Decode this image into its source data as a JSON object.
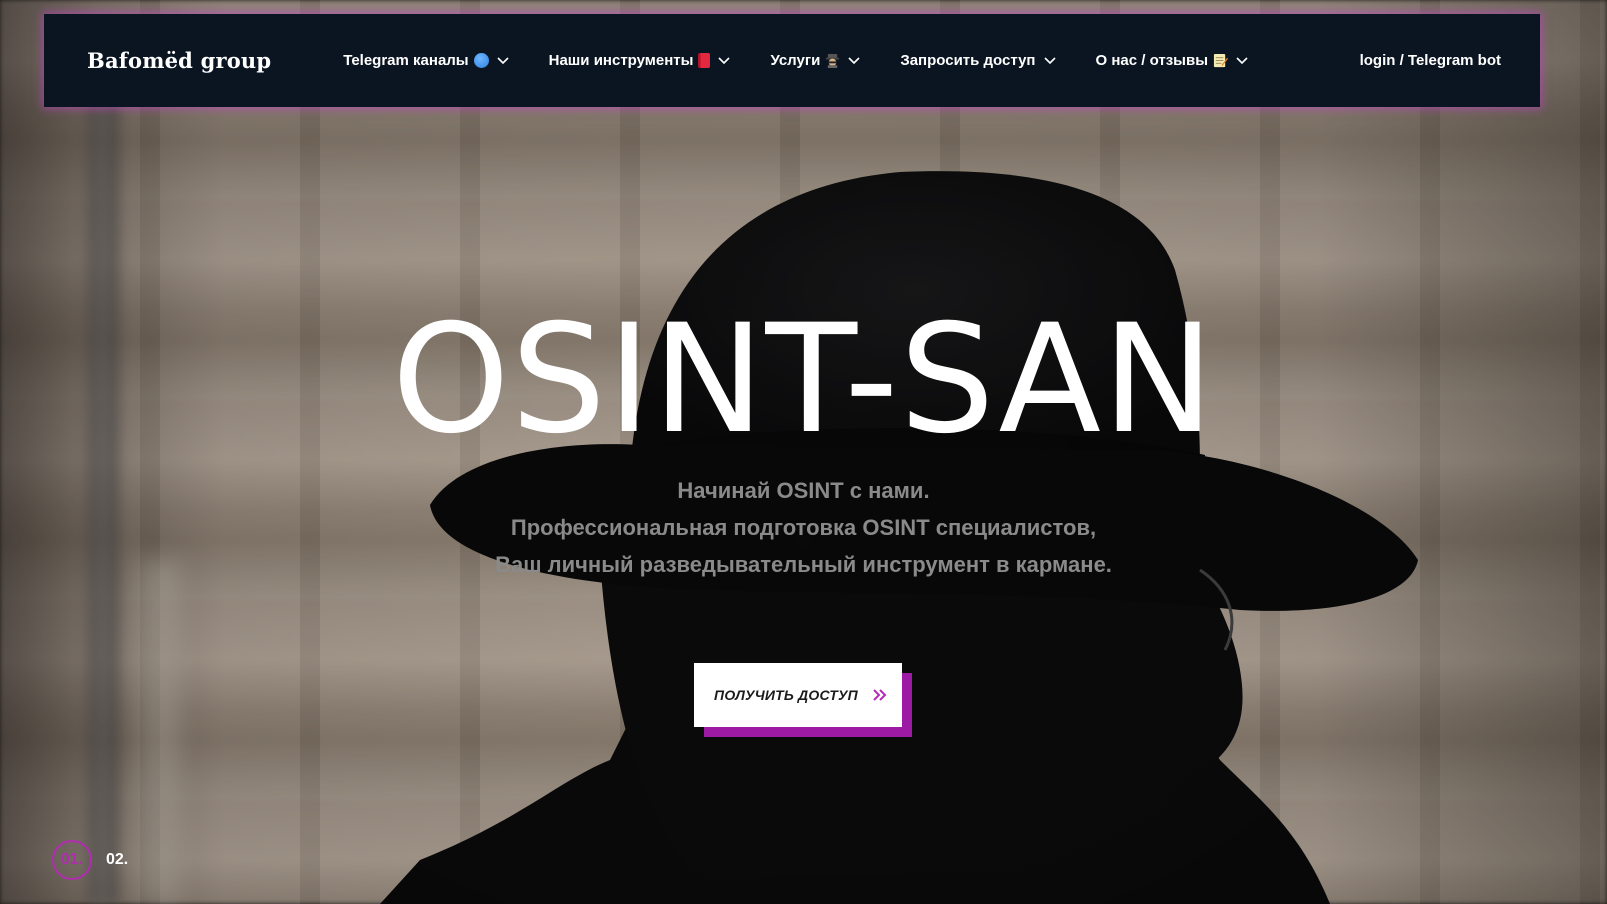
{
  "nav": {
    "logo": "Bafomëd group",
    "items": [
      {
        "label": "Telegram каналы",
        "icon": "blue-circle-icon"
      },
      {
        "label": "Наши инструменты",
        "icon": "red-book-icon"
      },
      {
        "label": "Услуги",
        "icon": "spy-icon"
      },
      {
        "label": "Запросить доступ",
        "icon": ""
      },
      {
        "label": "О нас / отзывы",
        "icon": "memo-icon"
      }
    ],
    "login": "login / Telegram bot"
  },
  "hero": {
    "title": "OSINT-SAN",
    "subtitle_lines": [
      "Начинай OSINT с нами.",
      "Профессиональная подготовка OSINT специалистов,",
      "Ваш личный разведывательный инструмент в кармане."
    ],
    "cta_label": "ПОЛУЧИТЬ ДОСТУП"
  },
  "slider": {
    "active": "01.",
    "next": "02."
  },
  "colors": {
    "nav_bg": "#0b1522",
    "accent": "#b12db0",
    "cta_shadow": "#9c1aa4",
    "subtitle": "#8a8a8a"
  }
}
